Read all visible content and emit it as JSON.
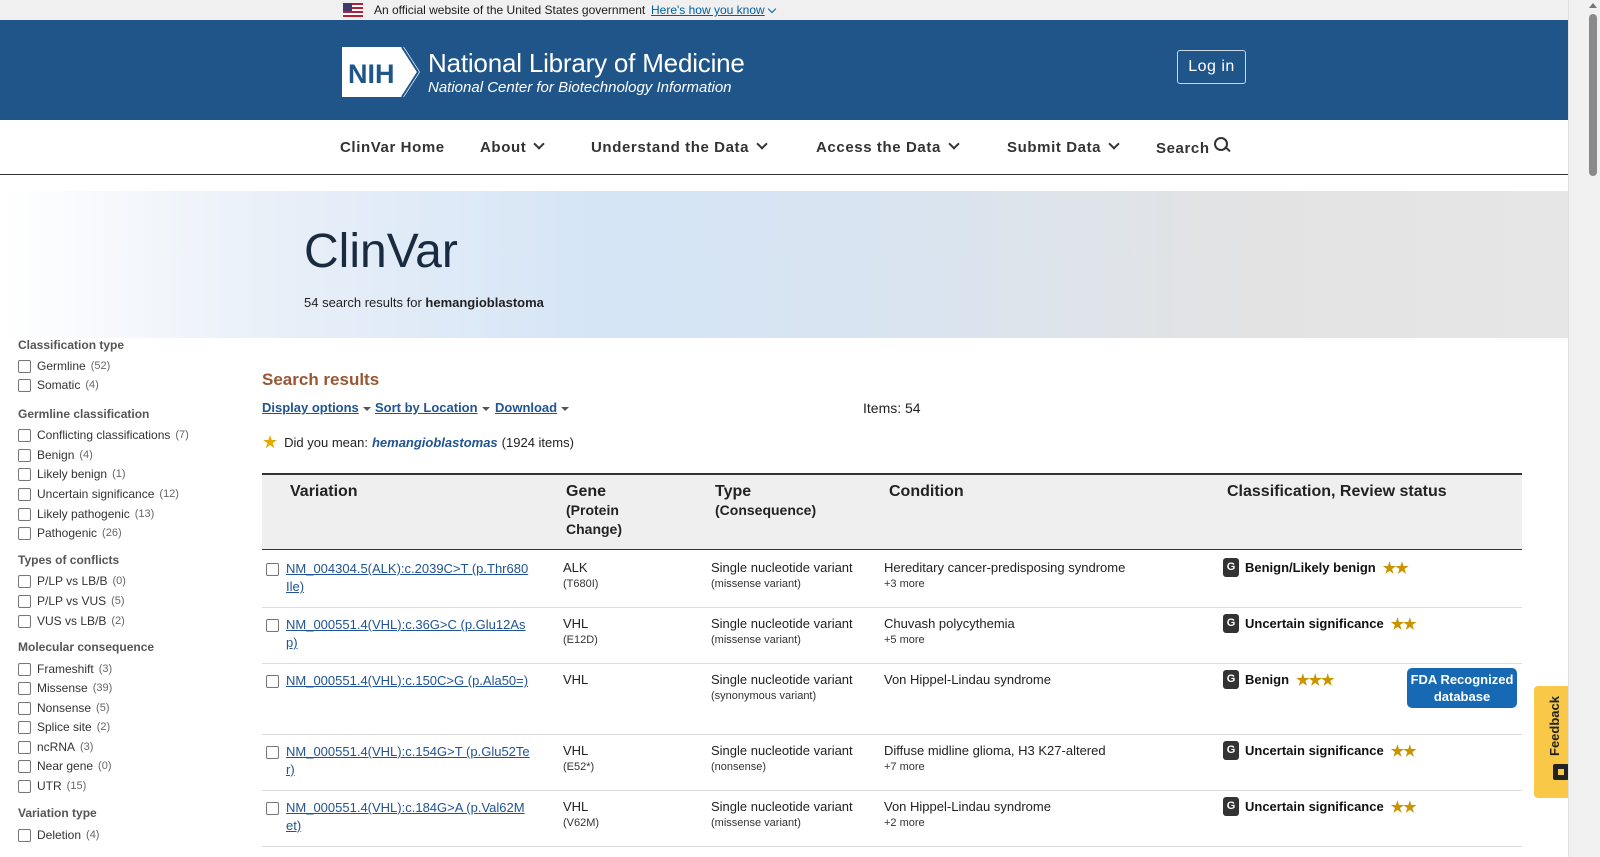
{
  "gov_banner": {
    "text": "An official website of the United States government",
    "link": "Here's how you know"
  },
  "header": {
    "logo_mark": "NIH",
    "title": "National Library of Medicine",
    "subtitle": "National Center for Biotechnology Information",
    "login_label": "Log in",
    "brand_color": "#20558a"
  },
  "nav": {
    "items": [
      {
        "label": "ClinVar Home"
      },
      {
        "label": "About"
      },
      {
        "label": "Understand the Data"
      },
      {
        "label": "Access the Data"
      },
      {
        "label": "Submit Data"
      },
      {
        "label": "Search"
      }
    ]
  },
  "hero": {
    "title": "ClinVar",
    "count_prefix": "54 search results for",
    "query": "hemangioblastoma"
  },
  "sidebar": {
    "groups": [
      {
        "heading": "Classification type",
        "items": [
          {
            "label": "Germline",
            "count": "(52)"
          },
          {
            "label": "Somatic",
            "count": "(4)"
          }
        ]
      },
      {
        "heading": "Germline classification",
        "items": [
          {
            "label": "Conflicting classifications",
            "count": "(7)"
          },
          {
            "label": "Benign",
            "count": "(4)"
          },
          {
            "label": "Likely benign",
            "count": "(1)"
          },
          {
            "label": "Uncertain significance",
            "count": "(12)"
          },
          {
            "label": "Likely pathogenic",
            "count": "(13)"
          },
          {
            "label": "Pathogenic",
            "count": "(26)"
          }
        ]
      },
      {
        "heading": "Types of conflicts",
        "items": [
          {
            "label": "P/LP vs LB/B",
            "count": "(0)"
          },
          {
            "label": "P/LP vs VUS",
            "count": "(5)"
          },
          {
            "label": "VUS vs LB/B",
            "count": "(2)"
          }
        ]
      },
      {
        "heading": "Molecular consequence",
        "items": [
          {
            "label": "Frameshift",
            "count": "(3)"
          },
          {
            "label": "Missense",
            "count": "(39)"
          },
          {
            "label": "Nonsense",
            "count": "(5)"
          },
          {
            "label": "Splice site",
            "count": "(2)"
          },
          {
            "label": "ncRNA",
            "count": "(3)"
          },
          {
            "label": "Near gene",
            "count": "(0)"
          },
          {
            "label": "UTR",
            "count": "(15)"
          }
        ]
      },
      {
        "heading": "Variation type",
        "items": [
          {
            "label": "Deletion",
            "count": "(4)"
          }
        ]
      }
    ]
  },
  "results": {
    "title": "Search results",
    "display_options": "Display options",
    "sort": "Sort by Location",
    "download": "Download",
    "items_count": "Items: 54",
    "suggest_prefix": "Did you mean:",
    "suggest_term": "hemangioblastomas",
    "suggest_suffix": "(1924 items)",
    "columns": {
      "variation": "Variation",
      "gene": "Gene",
      "gene_sub": "(Protein",
      "gene_sub2": "Change)",
      "type": "Type",
      "type_sub": "(Consequence)",
      "condition": "Condition",
      "classification": "Classification, Review status"
    },
    "rows": [
      {
        "variation": "NM_004304.5(ALK):c.2039C>T (p.Thr680Ile)",
        "gene": "ALK",
        "protein": "(T680I)",
        "type": "Single nucleotide variant",
        "consequence": "(missense variant)",
        "condition": "Hereditary cancer-predisposing syndrome",
        "more": "+3 more",
        "badge": "G",
        "classification": "Benign/Likely benign",
        "stars": "★★",
        "fda": ""
      },
      {
        "variation": "NM_000551.4(VHL):c.36G>C (p.Glu12Asp)",
        "gene": "VHL",
        "protein": "(E12D)",
        "type": "Single nucleotide variant",
        "consequence": "(missense variant)",
        "condition": "Chuvash polycythemia",
        "more": "+5 more",
        "badge": "G",
        "classification": "Uncertain significance",
        "stars": "★★",
        "fda": ""
      },
      {
        "variation": "NM_000551.4(VHL):c.150C>G (p.Ala50=)",
        "gene": "VHL",
        "protein": "",
        "type": "Single nucleotide variant",
        "consequence": "(synonymous variant)",
        "condition": "Von Hippel-Lindau syndrome",
        "more": "",
        "badge": "G",
        "classification": "Benign",
        "stars": "★★★",
        "fda": "FDA Recognized database"
      },
      {
        "variation": "NM_000551.4(VHL):c.154G>T (p.Glu52Ter)",
        "gene": "VHL",
        "protein": "(E52*)",
        "type": "Single nucleotide variant",
        "consequence": "(nonsense)",
        "condition": "Diffuse midline glioma, H3 K27-altered",
        "more": "+7 more",
        "badge": "G",
        "classification": "Uncertain significance",
        "stars": "★★",
        "fda": ""
      },
      {
        "variation": "NM_000551.4(VHL):c.184G>A (p.Val62Met)",
        "gene": "VHL",
        "protein": "(V62M)",
        "type": "Single nucleotide variant",
        "consequence": "(missense variant)",
        "condition": "Von Hippel-Lindau syndrome",
        "more": "+2 more",
        "badge": "G",
        "classification": "Uncertain significance",
        "stars": "★★",
        "fda": ""
      }
    ]
  },
  "feedback": {
    "label": "Feedback"
  }
}
